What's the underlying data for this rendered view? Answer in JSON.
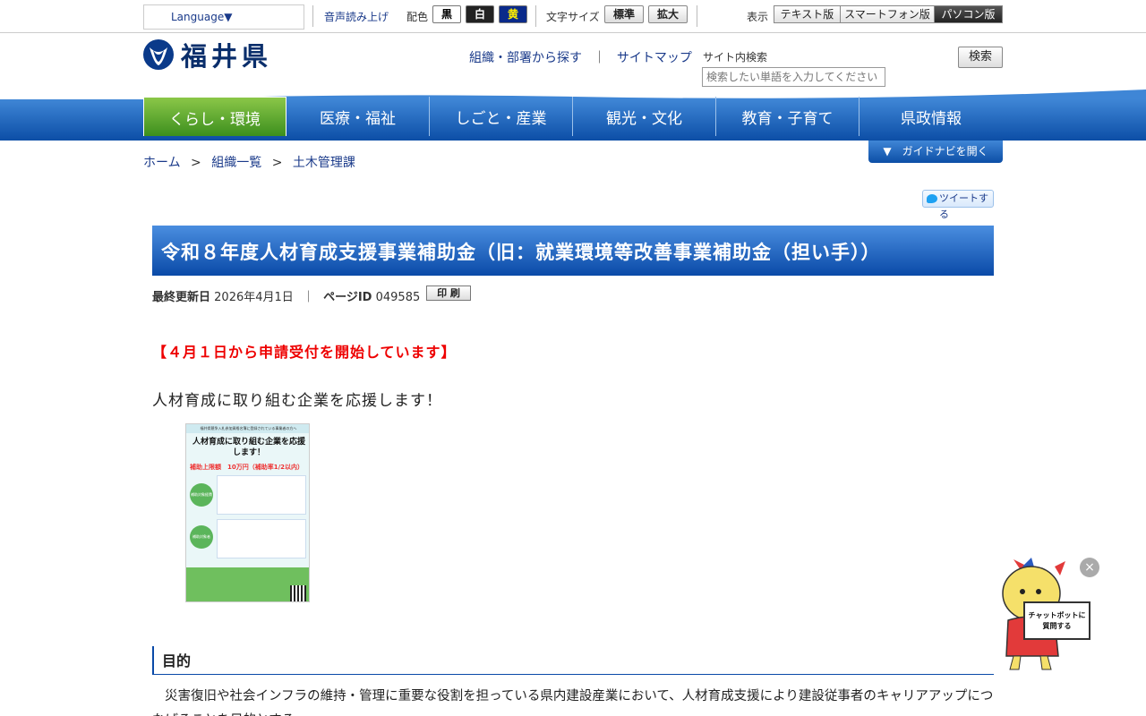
{
  "topbar": {
    "language": "Language▼",
    "voice": "音声読み上げ",
    "color_label": "配色",
    "colors": [
      {
        "label": "黒",
        "bg": "#ffffff",
        "fg": "#000000"
      },
      {
        "label": "白",
        "bg": "#222222",
        "fg": "#ffffff"
      },
      {
        "label": "黄",
        "bg": "#0a2a8a",
        "fg": "#ffee00"
      }
    ],
    "fontsize_label": "文字サイズ",
    "fontsize_normal": "標準",
    "fontsize_large": "拡大",
    "display_label": "表示",
    "views": [
      "テキスト版",
      "スマートフォン版",
      "パソコン版"
    ]
  },
  "header": {
    "logo_text": "福井県",
    "link_org": "組織・部署から探す",
    "link_sep": "｜",
    "link_sitemap": "サイトマップ",
    "search_label": "サイト内検索",
    "search_placeholder": "検索したい単語を入力してください",
    "search_button": "検索"
  },
  "nav": {
    "items": [
      "くらし・環境",
      "医療・福祉",
      "しごと・産業",
      "観光・文化",
      "教育・子育て",
      "県政情報"
    ],
    "active_color": "#5aa52d",
    "bar_color": "#0c4ea6"
  },
  "breadcrumb": {
    "items": [
      "ホーム",
      "組織一覧",
      "土木管理課"
    ],
    "sep": ">"
  },
  "guide_button": "▼　ガイドナビを開く",
  "tweet_button": "ツイートする",
  "page": {
    "title": "令和８年度人材育成支援事業補助金（旧：就業環境等改善事業補助金（担い手））",
    "updated_label": "最終更新日",
    "updated_date": "2026年4月1日",
    "meta_sep": "｜",
    "page_id_label": "ページID",
    "page_id": "049585",
    "print_button": "印 刷",
    "notice": "【４月１日から申請受付を開始しています】",
    "lead": "人材育成に取り組む企業を応援します！",
    "section_heading": "目的",
    "paragraph": "災害復旧や社会インフラの維持・管理に重要な役割を担っている県内建設産業において、人材育成支援により建設従事者のキャリアアップにつなげることを目的とする。"
  },
  "flyer": {
    "top_text": "福井県競争入札参加資格名簿に登録されている事業者の方へ",
    "headline": "人材育成に取り組む企業を応援します！",
    "cap": "補助上限額　10万円（補助率1/2以内）",
    "circle1": "補助対象経費",
    "circle2": "補助対象者"
  },
  "chatbot": {
    "close": "×",
    "sign": "チャットボットに質問する"
  }
}
